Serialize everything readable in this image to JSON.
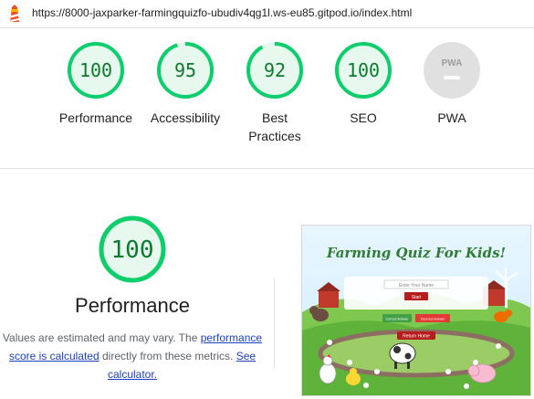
{
  "address_bar": {
    "url": "https://8000-jaxparker-farmingquizfo-ubudiv4qg1l.ws-eu85.gitpod.io/index.html"
  },
  "categories": [
    {
      "name": "performance",
      "label": "Performance",
      "score": "100",
      "score_value": 100
    },
    {
      "name": "accessibility",
      "label": "Accessibility",
      "score": "95",
      "score_value": 95
    },
    {
      "name": "best-practices",
      "label": "Best\nPractices",
      "score": "92",
      "score_value": 92
    },
    {
      "name": "seo",
      "label": "SEO",
      "score": "100",
      "score_value": 100
    },
    {
      "name": "pwa",
      "label": "PWA",
      "badge": "PWA"
    }
  ],
  "performance_section": {
    "score": "100",
    "score_value": 100,
    "title": "Performance",
    "desc_text_1": "Values are estimated and may vary. The ",
    "desc_link_1": "performance score is calculated",
    "desc_text_2": " directly from these metrics. ",
    "desc_link_2": "See calculator."
  },
  "screenshot": {
    "site_title": "Farming Quiz For Kids!",
    "input_placeholder": "Enter Your Name",
    "start_button": "Start",
    "green_button": "Correct Answer",
    "red_button": "Incorrect Answer",
    "return_button": "Return Home"
  },
  "colors": {
    "pass_green": "#0cce6b",
    "pass_text": "#0c7a2c",
    "pass_fill": "#e7f9ee",
    "pwa_gray": "#e0e0e0",
    "link_blue": "#1a3fbf"
  }
}
